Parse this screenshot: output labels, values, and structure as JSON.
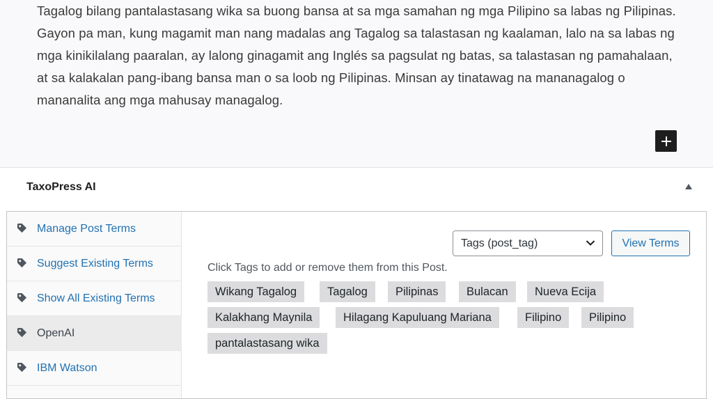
{
  "editor": {
    "paragraph": "Tagalog bilang pantalastasang wika sa buong bansa at sa mga samahan ng mga Pilipino sa labas ng Pilipinas. Gayon pa man, kung magamit man nang madalas ang Tagalog sa talastasan ng kaalaman, lalo na sa labas ng mga kinikilalang paaralan, ay lalong ginagamit ang Inglés sa pagsulat ng batas, sa talastasan ng pamahalaan, at sa kalakalan pang-ibang bansa man o sa loob ng Pilipinas. Minsan ay tinatawag na mananagalog o mananalita ang mga mahusay managalog."
  },
  "panel": {
    "title": "TaxoPress AI"
  },
  "sidebar": {
    "items": [
      {
        "label": "Manage Post Terms",
        "active": false
      },
      {
        "label": "Suggest Existing Terms",
        "active": false
      },
      {
        "label": "Show All Existing Terms",
        "active": false
      },
      {
        "label": "OpenAI",
        "active": true
      },
      {
        "label": "IBM Watson",
        "active": false
      }
    ]
  },
  "main": {
    "taxonomy_select": "Tags (post_tag)",
    "view_terms_label": "View Terms",
    "hint": "Click Tags to add or remove them from this Post.",
    "tags": [
      "Wikang Tagalog",
      "Tagalog",
      "Pilipinas",
      "Bulacan",
      "Nueva Ecija",
      "Kalakhang Maynila",
      "Hilagang Kapuluang Mariana",
      "Filipino",
      "Pilipino",
      "pantalastasang wika"
    ]
  },
  "colors": {
    "link": "#2271b1",
    "chip_bg": "#dcdcde",
    "add_block_bg": "#1e1e1e"
  }
}
